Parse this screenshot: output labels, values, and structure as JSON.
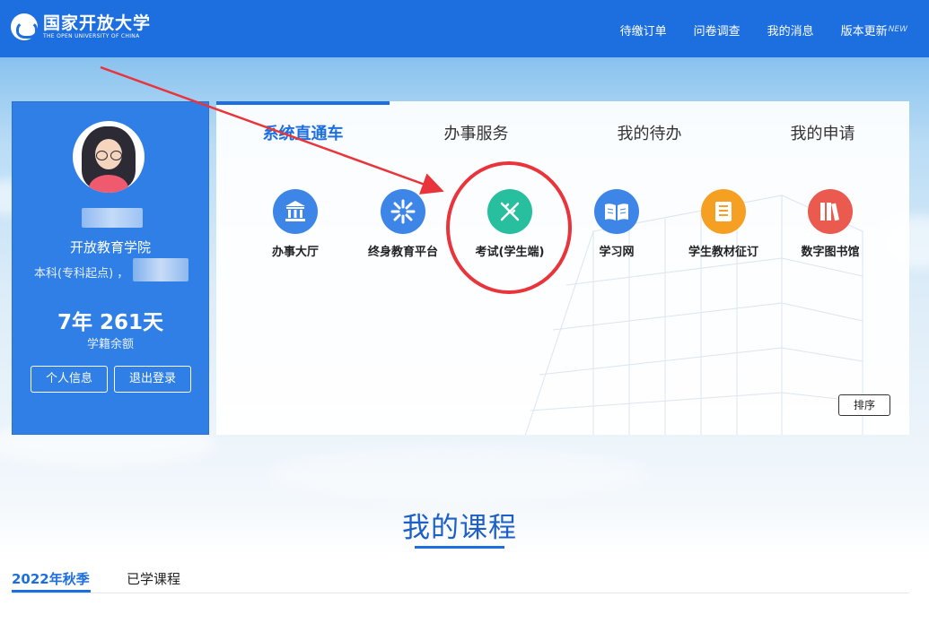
{
  "colors": {
    "brand": "#1d6fe0",
    "annotation": "#e8343a"
  },
  "header": {
    "logo_cn": "国家开放大学",
    "logo_en": "THE OPEN UNIVERSITY OF CHINA",
    "nav": [
      {
        "label": "待缴订单"
      },
      {
        "label": "问卷调查"
      },
      {
        "label": "我的消息"
      },
      {
        "label": "版本更新",
        "badge": "NEW"
      }
    ]
  },
  "profile": {
    "school": "开放教育学院",
    "degree": "本科(专科起点) ，",
    "time_remaining": "7年 261天",
    "time_label": "学籍余额",
    "buttons": [
      "个人信息",
      "退出登录"
    ]
  },
  "panel": {
    "tabs": [
      "系统直通车",
      "办事服务",
      "我的待办",
      "我的申请"
    ],
    "active_tab": 0,
    "apps": [
      {
        "label": "办事大厅",
        "icon": "bank-icon",
        "color": "#3d86e8"
      },
      {
        "label": "终身教育平台",
        "icon": "asterisk-icon",
        "color": "#3d86e8"
      },
      {
        "label": "考试(学生端)",
        "icon": "pencil-ruler-icon",
        "color": "#27bf9d"
      },
      {
        "label": "学习网",
        "icon": "book-icon",
        "color": "#3d86e8"
      },
      {
        "label": "学生教材征订",
        "icon": "textbook-icon",
        "color": "#f5a023"
      },
      {
        "label": "数字图书馆",
        "icon": "library-books-icon",
        "color": "#ea5a4e"
      }
    ],
    "sort_label": "排序"
  },
  "courses": {
    "title": "我的课程",
    "terms": [
      "2022年秋季",
      "已学课程"
    ]
  }
}
